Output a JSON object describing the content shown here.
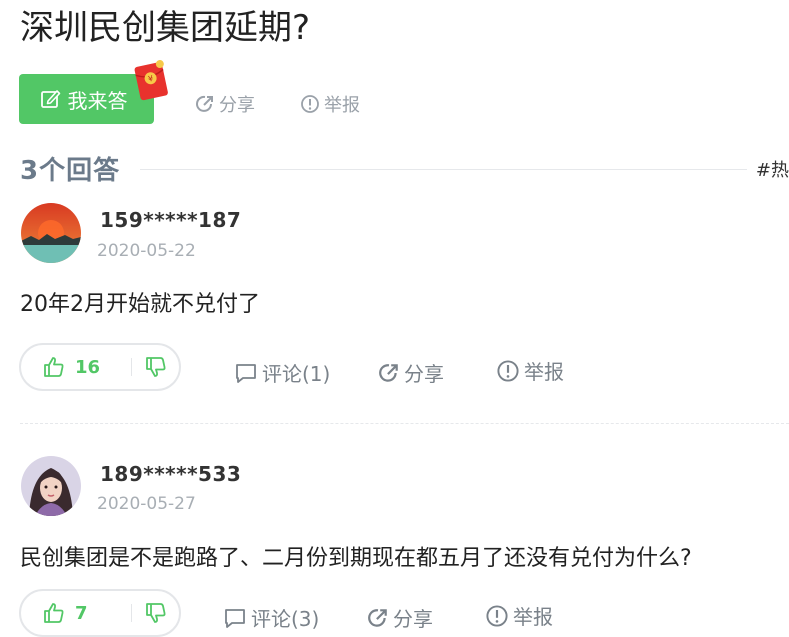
{
  "question": {
    "title": "深圳民创集团延期?"
  },
  "toolbar": {
    "answer_label": "我来答",
    "share_label": "分享",
    "report_label": "举报"
  },
  "answers_header": {
    "count_label": "3个回答",
    "sort_tag": "#热"
  },
  "answers": [
    {
      "username": "159*****187",
      "date": "2020-05-22",
      "content": "20年2月开始就不兑付了",
      "likes": "16",
      "comment_label": "评论(1)",
      "share_label": "分享",
      "report_label": "举报"
    },
    {
      "username": "189*****533",
      "date": "2020-05-27",
      "content": "民创集团是不是跑路了、二月份到期现在都五月了还没有兑付为什么?",
      "likes": "7",
      "comment_label": "评论(3)",
      "share_label": "分享",
      "report_label": "举报"
    }
  ],
  "colors": {
    "accent": "#52c766",
    "muted": "#9aa1a9",
    "red_packet": "#e8322d"
  }
}
